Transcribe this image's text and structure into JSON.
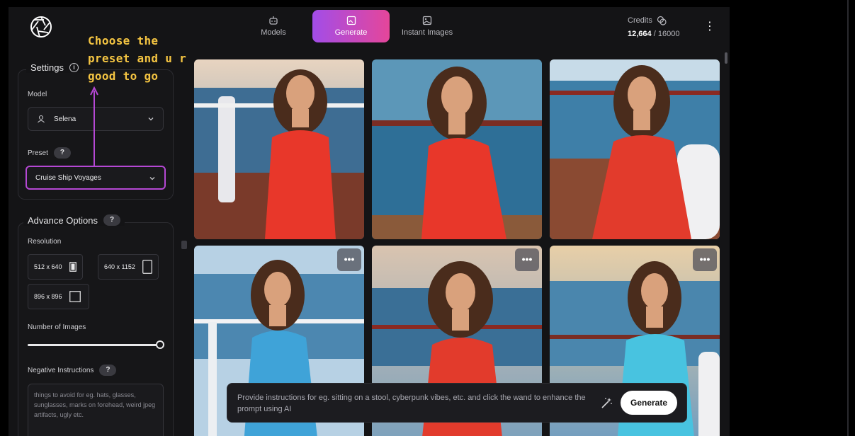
{
  "nav": {
    "tabs": [
      {
        "label": "Models",
        "icon": "robot-icon"
      },
      {
        "label": "Generate",
        "icon": "image-frame-icon",
        "active": true
      },
      {
        "label": "Instant Images",
        "icon": "photo-icon"
      }
    ]
  },
  "credits": {
    "label": "Credits",
    "current": "12,664",
    "separator": "/",
    "total": "16000"
  },
  "annotation": {
    "line1": "Choose the",
    "line2": "preset and u r",
    "line3": "good to go",
    "color": "#f5c542"
  },
  "settings": {
    "title": "Settings",
    "model_label": "Model",
    "model_value": "Selena",
    "preset_label": "Preset",
    "preset_help": "?",
    "preset_value": "Cruise Ship Voyages"
  },
  "advance": {
    "title": "Advance Options",
    "help": "?",
    "resolution_label": "Resolution",
    "resolutions": [
      "512 x 640",
      "640 x 1152",
      "896 x 896"
    ],
    "selected_resolution": "512 x 640",
    "num_images_label": "Number of Images",
    "num_images_fraction": 1.0,
    "negative_label": "Negative Instructions",
    "negative_help": "?",
    "negative_placeholder": "things to avoid for eg. hats, glasses, sunglasses, marks on forehead, weird jpeg artifacts, ugly etc."
  },
  "gallery": {
    "images": [
      {
        "dress": "red",
        "menu": "•••"
      },
      {
        "dress": "red",
        "menu": "•••"
      },
      {
        "dress": "red",
        "menu": "•••"
      },
      {
        "dress": "blue",
        "menu": "•••"
      },
      {
        "dress": "red",
        "menu": "•••"
      },
      {
        "dress": "light-blue",
        "menu": "•••"
      }
    ]
  },
  "prompt": {
    "placeholder": "Provide instructions for eg. sitting on a stool, cyberpunk vibes, etc. and click the wand to enhance the prompt using AI",
    "button_label": "Generate"
  },
  "colors": {
    "accent_gradient_start": "#a24de8",
    "accent_gradient_end": "#e5469a",
    "preset_highlight": "#b548d4",
    "background": "#141416"
  }
}
